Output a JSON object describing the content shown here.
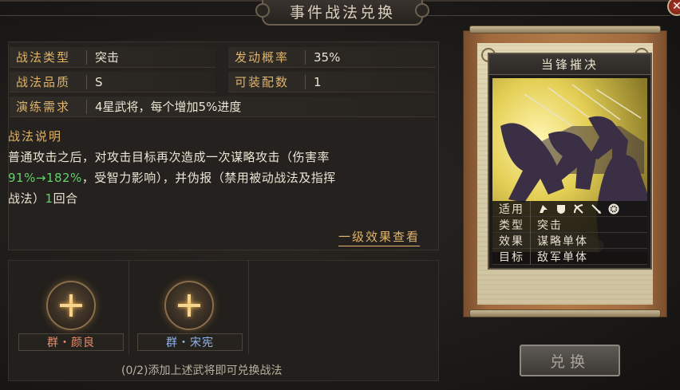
{
  "window": {
    "title": "事件战法兑换",
    "close_label": "✕"
  },
  "info": {
    "type_label": "战法类型",
    "type_value": "突击",
    "rate_label": "发动概率",
    "rate_value": "35%",
    "quality_label": "战法品质",
    "quality_value": "S",
    "equip_label": "可装配数",
    "equip_value": "1",
    "train_label": "演练需求",
    "train_value": "4星武将，每个增加5%进度"
  },
  "description": {
    "title": "战法说明",
    "line1": "普通攻击之后，对攻击目标再次造成一次谋略攻击（伤害率",
    "line2_green": "91%→182%",
    "line2_rest": "，受智力影响），并伪报（禁用被动战法及指挥",
    "line3_a": "战法）",
    "line3_green": "1",
    "line3_b": "回合"
  },
  "effect_link": "一级效果查看",
  "slots": [
    {
      "label": "群・颜良",
      "color": "#e88c6a"
    },
    {
      "label": "群・宋宪",
      "color": "#8fb4e8"
    }
  ],
  "hint": "(0/2)添加上述武将即可兑换战法",
  "card": {
    "title": "当锋摧决",
    "apply_label": "适用",
    "apply_icons": [
      "cavalry-icon",
      "shield-icon",
      "bow-icon",
      "spear-icon",
      "wheel-icon"
    ],
    "kind_label": "类型",
    "kind_value": "突击",
    "effect_label": "效果",
    "effect_value": "谋略单体",
    "target_label": "目标",
    "target_value": "敌军单体"
  },
  "exchange_button": "兑换"
}
